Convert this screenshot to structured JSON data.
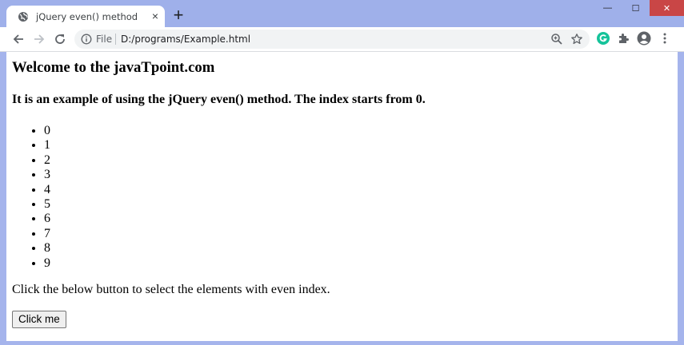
{
  "browser": {
    "tab_title": "jQuery even() method",
    "tab_close": "×",
    "new_tab": "+",
    "address_scheme": "File",
    "address_url": "D:/programs/Example.html"
  },
  "window_controls": {
    "minimize": "—",
    "maximize": "☐",
    "close": "✕"
  },
  "page": {
    "heading": "Welcome to the javaTpoint.com",
    "subheading": "It is an example of using the jQuery even() method. The index starts from 0.",
    "list_items": [
      "0",
      "1",
      "2",
      "3",
      "4",
      "5",
      "6",
      "7",
      "8",
      "9"
    ],
    "instruction": "Click the below button to select the elements with even index.",
    "button_label": "Click me"
  },
  "icons": {
    "favicon": "globe-icon",
    "back": "back-arrow-icon",
    "forward": "forward-arrow-icon",
    "reload": "reload-icon",
    "info": "info-icon",
    "zoom": "zoom-icon",
    "bookmark": "star-icon",
    "grammarly": "grammarly-icon",
    "extensions": "puzzle-icon",
    "profile": "profile-icon",
    "menu": "kebab-menu-icon"
  },
  "colors": {
    "frame": "#a5b4ec",
    "close_button": "#c94646",
    "grammarly": "#15c39a"
  }
}
